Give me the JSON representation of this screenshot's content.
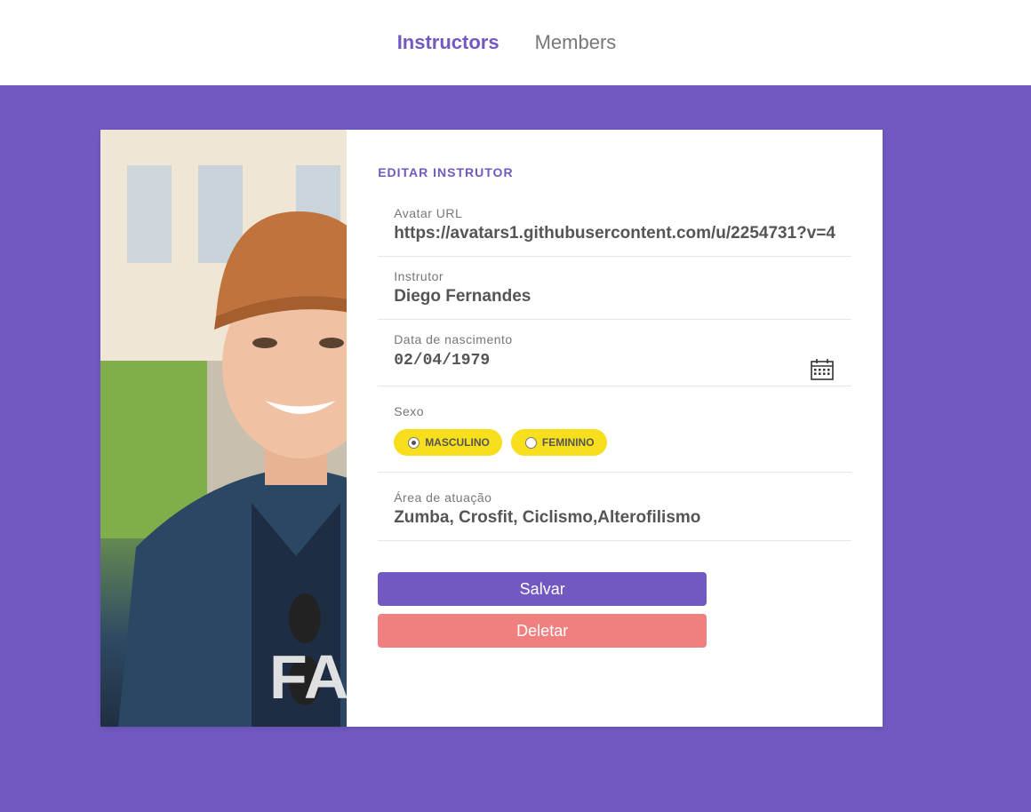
{
  "nav": {
    "items": [
      {
        "label": "Instructors",
        "active": true
      },
      {
        "label": "Members",
        "active": false
      }
    ]
  },
  "form": {
    "title": "EDITAR INSTRUTOR",
    "avatar_url": {
      "label": "Avatar URL",
      "value": "https://avatars1.githubusercontent.com/u/2254731?v=4"
    },
    "name": {
      "label": "Instrutor",
      "value": "Diego Fernandes"
    },
    "birth": {
      "label": "Data de nascimento",
      "value": "02/04/1979"
    },
    "gender": {
      "label": "Sexo",
      "options": [
        {
          "label": "MASCULINO",
          "checked": true
        },
        {
          "label": "FEMININO",
          "checked": false
        }
      ]
    },
    "services": {
      "label": "Área de atuação",
      "value": "Zumba, Crosfit, Ciclismo,Alterofilismo"
    },
    "save_label": "Salvar",
    "delete_label": "Deletar"
  },
  "colors": {
    "primary": "#7159c1",
    "accent_yellow": "#f7df1e",
    "delete": "#f08080"
  },
  "icons": {
    "calendar": "calendar-icon"
  }
}
